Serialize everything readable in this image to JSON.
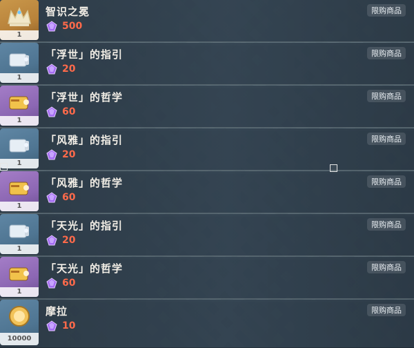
{
  "items": [
    {
      "name": "智识之冕",
      "price": "500",
      "qty": "1",
      "badge": "限购商品",
      "icon": "crown-icon"
    },
    {
      "name": "「浮世」的指引",
      "price": "20",
      "qty": "1",
      "badge": "限购商品",
      "icon": "guide-book-icon"
    },
    {
      "name": "「浮世」的哲学",
      "price": "60",
      "qty": "1",
      "badge": "限购商品",
      "icon": "philosophy-book-icon"
    },
    {
      "name": "「风雅」的指引",
      "price": "20",
      "qty": "1",
      "badge": "限购商品",
      "icon": "guide-book-icon"
    },
    {
      "name": "「风雅」的哲学",
      "price": "60",
      "qty": "1",
      "badge": "限购商品",
      "icon": "philosophy-book-icon"
    },
    {
      "name": "「天光」的指引",
      "price": "20",
      "qty": "1",
      "badge": "限购商品",
      "icon": "guide-book-icon"
    },
    {
      "name": "「天光」的哲学",
      "price": "60",
      "qty": "1",
      "badge": "限购商品",
      "icon": "philosophy-book-icon"
    },
    {
      "name": "摩拉",
      "price": "10",
      "qty": "10000",
      "badge": "限购商品",
      "icon": "mora-coin-icon"
    }
  ],
  "colors": {
    "price": "#ff6a4a",
    "text": "#f2eee6",
    "badge_bg": "rgba(255,255,255,0.12)"
  }
}
